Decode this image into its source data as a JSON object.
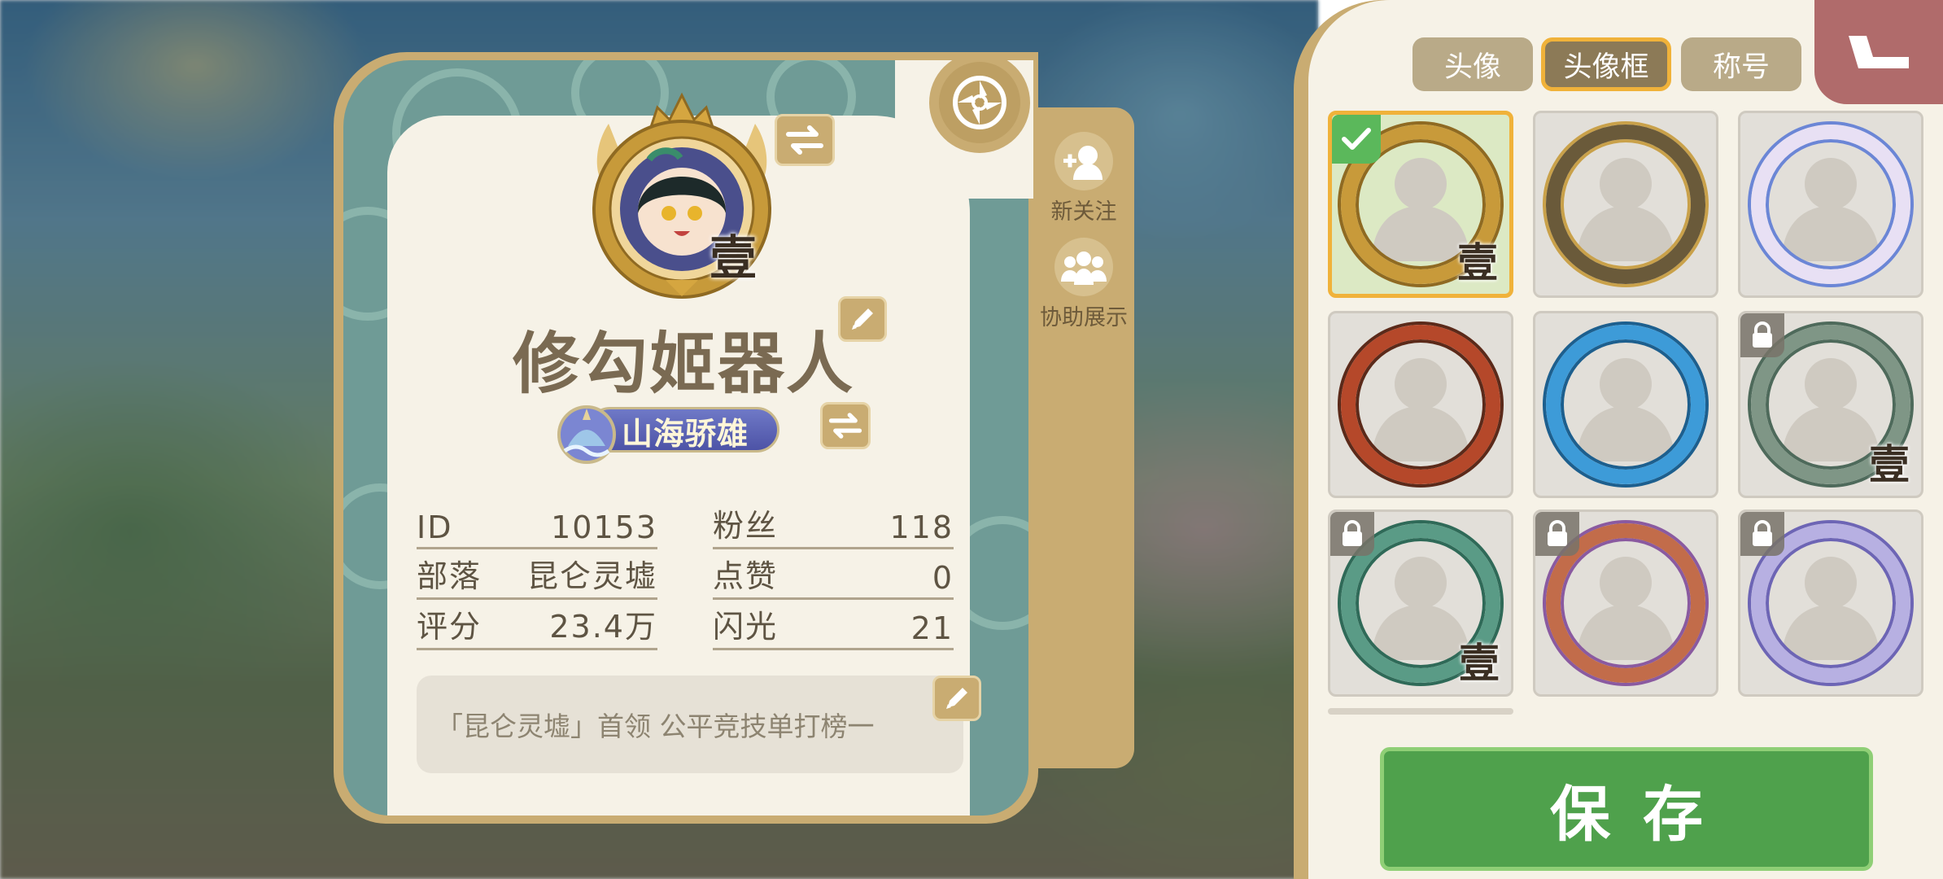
{
  "profile": {
    "name": "修勾姬器人",
    "title_badge": "山海骄雄",
    "frame_mark": "壹",
    "stats": {
      "id_label": "ID",
      "id_value": "10153",
      "fans_label": "粉丝",
      "fans_value": "118",
      "tribe_label": "部落",
      "tribe_value": "昆仑灵墟",
      "likes_label": "点赞",
      "likes_value": "0",
      "score_label": "评分",
      "score_value": "23.4万",
      "flash_label": "闪光",
      "flash_value": "21"
    },
    "signature": "「昆仑灵墟」首领 公平竞技单打榜一"
  },
  "side_actions": {
    "follow_label": "新关注",
    "assist_label": "协助展示"
  },
  "tabs": [
    "头像",
    "头像框",
    "称号"
  ],
  "active_tab": "头像框",
  "frames": [
    {
      "name": "gold-wreath-frame",
      "selected": true,
      "locked": false,
      "mark": "壹"
    },
    {
      "name": "hexagon-flower-frame",
      "selected": false,
      "locked": false
    },
    {
      "name": "cat-ear-bow-frame",
      "selected": false,
      "locked": false
    },
    {
      "name": "phoenix-feather-frame",
      "selected": false,
      "locked": false
    },
    {
      "name": "water-dragon-frame",
      "selected": false,
      "locked": false
    },
    {
      "name": "jade-ring-frame",
      "selected": false,
      "locked": true,
      "mark": "壹"
    },
    {
      "name": "teal-pattern-frame",
      "selected": false,
      "locked": true,
      "mark": "壹"
    },
    {
      "name": "autumn-flower-frame",
      "selected": false,
      "locked": true
    },
    {
      "name": "spirit-fox-frame",
      "selected": false,
      "locked": true
    }
  ],
  "save_label": "保存",
  "colors": {
    "panel_bg": "#f6f2e7",
    "gold": "#c9ac72",
    "teal": "#6f9b96",
    "save_green": "#4fa14c",
    "active_tab_border": "#f0b23a",
    "back_button": "#b06b6b"
  }
}
